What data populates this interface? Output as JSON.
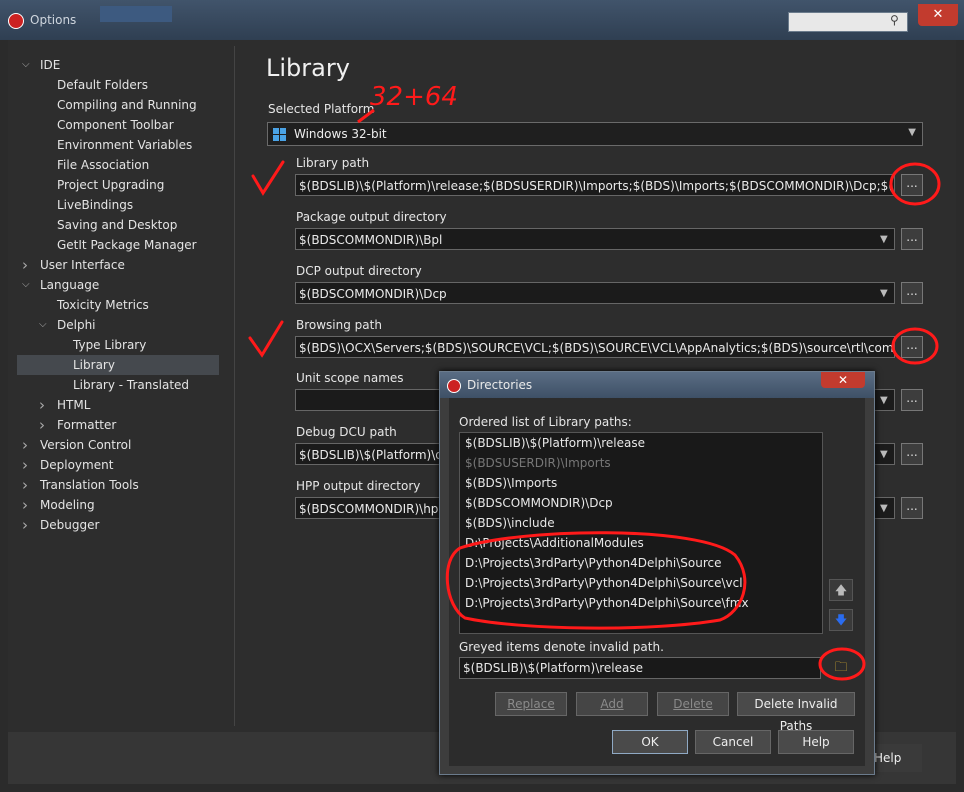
{
  "window": {
    "title": "Options",
    "close_label": "✕"
  },
  "tree": {
    "items": [
      {
        "label": "IDE",
        "level": 0,
        "expanded": true
      },
      {
        "label": "Default Folders",
        "level": 1
      },
      {
        "label": "Compiling and Running",
        "level": 1
      },
      {
        "label": "Component Toolbar",
        "level": 1
      },
      {
        "label": "Environment Variables",
        "level": 1
      },
      {
        "label": "File Association",
        "level": 1
      },
      {
        "label": "Project Upgrading",
        "level": 1
      },
      {
        "label": "LiveBindings",
        "level": 1
      },
      {
        "label": "Saving and Desktop",
        "level": 1
      },
      {
        "label": "GetIt Package Manager",
        "level": 1
      },
      {
        "label": "User Interface",
        "level": 0,
        "expanded": false
      },
      {
        "label": "Language",
        "level": 0,
        "expanded": true
      },
      {
        "label": "Toxicity Metrics",
        "level": 1
      },
      {
        "label": "Delphi",
        "level": 1,
        "expanded": true
      },
      {
        "label": "Type Library",
        "level": 2
      },
      {
        "label": "Library",
        "level": 2,
        "selected": true
      },
      {
        "label": "Library - Translated",
        "level": 2
      },
      {
        "label": "HTML",
        "level": 1,
        "expanded": false
      },
      {
        "label": "Formatter",
        "level": 1,
        "expanded": false
      },
      {
        "label": "Version Control",
        "level": 0,
        "expanded": false
      },
      {
        "label": "Deployment",
        "level": 0,
        "expanded": false
      },
      {
        "label": "Translation Tools",
        "level": 0,
        "expanded": false
      },
      {
        "label": "Modeling",
        "level": 0,
        "expanded": false
      },
      {
        "label": "Debugger",
        "level": 0,
        "expanded": false
      }
    ]
  },
  "library": {
    "title": "Library",
    "platform_label": "Selected Platform",
    "platform_value": "Windows 32-bit",
    "library_path_label": "Library path",
    "library_path_value": "$(BDSLIB)\\$(Platform)\\release;$(BDSUSERDIR)\\Imports;$(BDS)\\Imports;$(BDSCOMMONDIR)\\Dcp;$(BDS)\\inclu",
    "package_output_label": "Package output directory",
    "package_output_value": "$(BDSCOMMONDIR)\\Bpl",
    "dcp_output_label": "DCP output directory",
    "dcp_output_value": "$(BDSCOMMONDIR)\\Dcp",
    "browsing_path_label": "Browsing path",
    "browsing_path_value": "$(BDS)\\OCX\\Servers;$(BDS)\\SOURCE\\VCL;$(BDS)\\SOURCE\\VCL\\AppAnalytics;$(BDS)\\source\\rtl\\common;$(Bl",
    "unit_scope_label": "Unit scope names",
    "unit_scope_value": "",
    "debug_dcu_label": "Debug DCU path",
    "debug_dcu_value": "$(BDSLIB)\\$(Platform)\\deb",
    "hpp_output_label": "HPP output directory",
    "hpp_output_value": "$(BDSCOMMONDIR)\\hpp\\",
    "ellipsis": "...",
    "help_label": "Help"
  },
  "dialog": {
    "title": "Directories",
    "close_label": "✕",
    "list_label": "Ordered list of Library paths:",
    "paths": [
      {
        "text": "$(BDSLIB)\\$(Platform)\\release",
        "invalid": false
      },
      {
        "text": "$(BDSUSERDIR)\\Imports",
        "invalid": true
      },
      {
        "text": "$(BDS)\\Imports",
        "invalid": false
      },
      {
        "text": "$(BDSCOMMONDIR)\\Dcp",
        "invalid": false
      },
      {
        "text": "$(BDS)\\include",
        "invalid": false
      },
      {
        "text": "D:\\Projects\\AdditionalModules",
        "invalid": false
      },
      {
        "text": "D:\\Projects\\3rdParty\\Python4Delphi\\Source",
        "invalid": false
      },
      {
        "text": "D:\\Projects\\3rdParty\\Python4Delphi\\Source\\vcl",
        "invalid": false
      },
      {
        "text": "D:\\Projects\\3rdParty\\Python4Delphi\\Source\\fmx",
        "invalid": false
      }
    ],
    "greyed_note": "Greyed items denote invalid path.",
    "path_input_value": "$(BDSLIB)\\$(Platform)\\release",
    "replace_label": "Replace",
    "add_label": "Add",
    "delete_label": "Delete",
    "delete_invalid_label": "Delete Invalid Paths",
    "ok_label": "OK",
    "cancel_label": "Cancel",
    "help_label": "Help"
  },
  "annotation": {
    "text": "32+64",
    "color": "#ff0000"
  }
}
